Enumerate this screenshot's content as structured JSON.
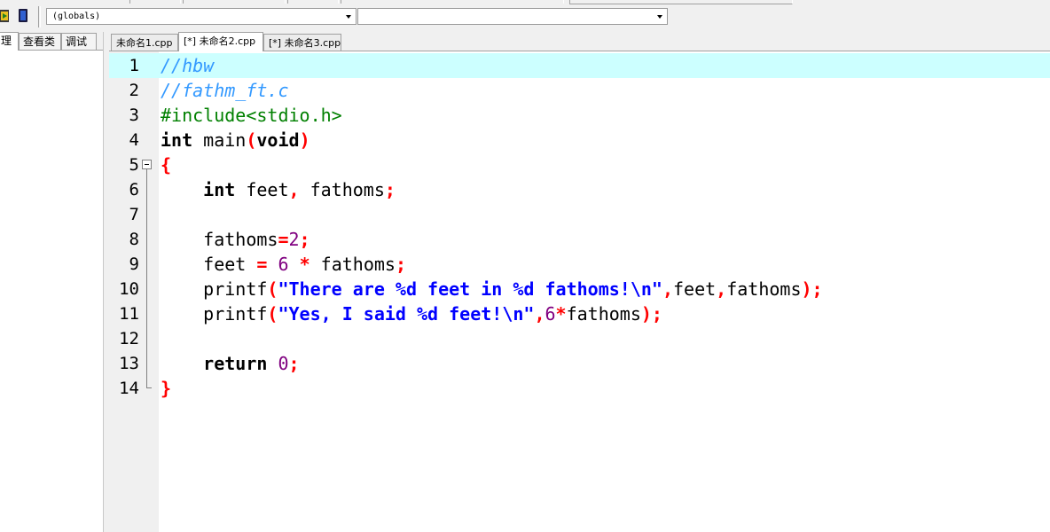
{
  "toolbar": {
    "scope_combo": "(globals)",
    "member_combo": ""
  },
  "left_panel": {
    "tabs": [
      "理",
      "查看类",
      "调试"
    ]
  },
  "editor_tabs": [
    {
      "label": "未命名1.cpp",
      "active": false
    },
    {
      "label": "[*] 未命名2.cpp",
      "active": true
    },
    {
      "label": "[*] 未命名3.cpp",
      "active": false
    }
  ],
  "editor": {
    "current_line": 1,
    "lines": [
      {
        "n": "1",
        "tokens": [
          {
            "t": "//hbw",
            "c": "cm"
          }
        ]
      },
      {
        "n": "2",
        "tokens": [
          {
            "t": "//fathm_ft.c",
            "c": "cm"
          }
        ]
      },
      {
        "n": "3",
        "tokens": [
          {
            "t": "#include<stdio.h>",
            "c": "pp"
          }
        ]
      },
      {
        "n": "4",
        "tokens": [
          {
            "t": "int",
            "c": "kw"
          },
          {
            "t": " main",
            "c": "id"
          },
          {
            "t": "(",
            "c": "sy"
          },
          {
            "t": "void",
            "c": "kw"
          },
          {
            "t": ")",
            "c": "sy"
          }
        ]
      },
      {
        "n": "5",
        "tokens": [
          {
            "t": "{",
            "c": "sy"
          }
        ]
      },
      {
        "n": "6",
        "tokens": [
          {
            "t": "    ",
            "c": "id"
          },
          {
            "t": "int",
            "c": "kw"
          },
          {
            "t": " feet",
            "c": "id"
          },
          {
            "t": ",",
            "c": "sy"
          },
          {
            "t": " fathoms",
            "c": "id"
          },
          {
            "t": ";",
            "c": "sy"
          }
        ]
      },
      {
        "n": "7",
        "tokens": []
      },
      {
        "n": "8",
        "tokens": [
          {
            "t": "    fathoms",
            "c": "id"
          },
          {
            "t": "=",
            "c": "sy"
          },
          {
            "t": "2",
            "c": "nm"
          },
          {
            "t": ";",
            "c": "sy"
          }
        ]
      },
      {
        "n": "9",
        "tokens": [
          {
            "t": "    feet ",
            "c": "id"
          },
          {
            "t": "=",
            "c": "sy"
          },
          {
            "t": " ",
            "c": "id"
          },
          {
            "t": "6",
            "c": "nm"
          },
          {
            "t": " ",
            "c": "id"
          },
          {
            "t": "*",
            "c": "sy"
          },
          {
            "t": " fathoms",
            "c": "id"
          },
          {
            "t": ";",
            "c": "sy"
          }
        ]
      },
      {
        "n": "10",
        "tokens": [
          {
            "t": "    printf",
            "c": "id"
          },
          {
            "t": "(",
            "c": "sy"
          },
          {
            "t": "\"There are %d feet in %d fathoms!\\n\"",
            "c": "st"
          },
          {
            "t": ",",
            "c": "sy"
          },
          {
            "t": "feet",
            "c": "id"
          },
          {
            "t": ",",
            "c": "sy"
          },
          {
            "t": "fathoms",
            "c": "id"
          },
          {
            "t": ");",
            "c": "sy"
          }
        ]
      },
      {
        "n": "11",
        "tokens": [
          {
            "t": "    printf",
            "c": "id"
          },
          {
            "t": "(",
            "c": "sy"
          },
          {
            "t": "\"Yes, I said %d feet!\\n\"",
            "c": "st"
          },
          {
            "t": ",",
            "c": "sy"
          },
          {
            "t": "6",
            "c": "nm"
          },
          {
            "t": "*",
            "c": "sy"
          },
          {
            "t": "fathoms",
            "c": "id"
          },
          {
            "t": ");",
            "c": "sy"
          }
        ]
      },
      {
        "n": "12",
        "tokens": []
      },
      {
        "n": "13",
        "tokens": [
          {
            "t": "    ",
            "c": "id"
          },
          {
            "t": "return",
            "c": "kw"
          },
          {
            "t": " ",
            "c": "id"
          },
          {
            "t": "0",
            "c": "nm"
          },
          {
            "t": ";",
            "c": "sy"
          }
        ]
      },
      {
        "n": "14",
        "tokens": [
          {
            "t": "}",
            "c": "sy"
          }
        ]
      }
    ]
  }
}
